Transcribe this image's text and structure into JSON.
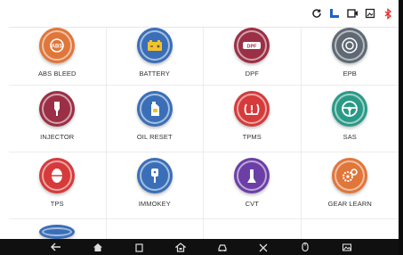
{
  "status_icons": [
    "sync-icon",
    "signal-icon",
    "video-icon",
    "screenshot-icon",
    "bluetooth-icon"
  ],
  "colors": {
    "orange": "#e0763a",
    "blue": "#3a6fb8",
    "maroon": "#9b2f45",
    "gray": "#5f6973",
    "teal": "#2a9a87",
    "red": "#d63a3a",
    "purple": "#6b3fa6",
    "status_red": "#e53030",
    "status_blue": "#1e62c9"
  },
  "functions": [
    {
      "label": "ABS BLEED",
      "icon": "abs-icon",
      "color": "orange"
    },
    {
      "label": "BATTERY",
      "icon": "battery-icon",
      "color": "blue"
    },
    {
      "label": "DPF",
      "icon": "dpf-icon",
      "color": "maroon"
    },
    {
      "label": "EPB",
      "icon": "epb-icon",
      "color": "gray"
    },
    {
      "label": "INJECTOR",
      "icon": "injector-icon",
      "color": "maroon"
    },
    {
      "label": "OIL RESET",
      "icon": "oil-icon",
      "color": "blue"
    },
    {
      "label": "TPMS",
      "icon": "tpms-icon",
      "color": "red"
    },
    {
      "label": "SAS",
      "icon": "steering-icon",
      "color": "teal"
    },
    {
      "label": "TPS",
      "icon": "throttle-icon",
      "color": "red"
    },
    {
      "label": "IMMOKEY",
      "icon": "key-icon",
      "color": "blue"
    },
    {
      "label": "CVT",
      "icon": "gear-shift-icon",
      "color": "purple"
    },
    {
      "label": "GEAR LEARN",
      "icon": "gears-icon",
      "color": "orange"
    }
  ],
  "nav_icons": [
    "back-icon",
    "home-icon",
    "recent-apps-icon",
    "vci-home-icon",
    "car-icon",
    "tools-icon",
    "mouse-icon",
    "gallery-icon"
  ]
}
